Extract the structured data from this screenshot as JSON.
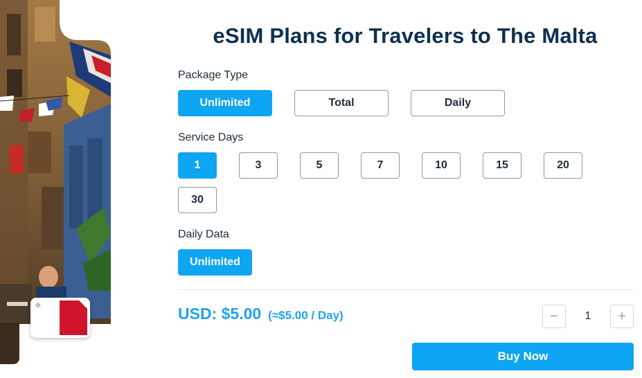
{
  "title": "eSIM Plans for Travelers to The Malta",
  "package_type": {
    "label": "Package Type",
    "options": [
      "Unlimited",
      "Total",
      "Daily"
    ],
    "selected": "Unlimited"
  },
  "service_days": {
    "label": "Service Days",
    "options": [
      "1",
      "3",
      "5",
      "7",
      "10",
      "15",
      "20",
      "30"
    ],
    "selected": "1"
  },
  "daily_data": {
    "label": "Daily Data",
    "options": [
      "Unlimited"
    ],
    "selected": "Unlimited"
  },
  "price": {
    "main": "USD: $5.00",
    "per_day": "(≈$5.00 / Day)"
  },
  "quantity": {
    "value": "1",
    "minus": "−",
    "plus": "+"
  },
  "buy_label": "Buy Now",
  "colors": {
    "accent": "#0ea5f2",
    "title": "#0d3050",
    "price": "#20a3ee",
    "malta_red": "#cf142b"
  },
  "icons": {
    "minus": "minus-icon",
    "plus": "plus-icon",
    "flag": "malta-flag-icon"
  }
}
